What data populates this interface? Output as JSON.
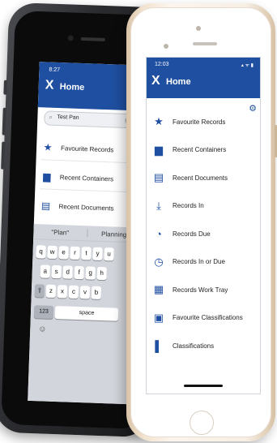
{
  "back_phone": {
    "time": "8:27",
    "title": "Home",
    "logo": "X",
    "search": {
      "value": "Test Pan"
    },
    "items": [
      {
        "label": "Favourite Records",
        "icon": "star-icon",
        "glyph": "★"
      },
      {
        "label": "Recent Containers",
        "icon": "folder-icon",
        "glyph": "▆"
      },
      {
        "label": "Recent Documents",
        "icon": "document-icon",
        "glyph": "▤"
      }
    ],
    "keyboard": {
      "suggestions": [
        "\"Plan\"",
        "Planning"
      ],
      "row1": [
        "q",
        "w",
        "e",
        "r",
        "t",
        "y",
        "u"
      ],
      "row2": [
        "a",
        "s",
        "d",
        "f",
        "g",
        "h"
      ],
      "row3": [
        "⇧",
        "z",
        "x",
        "c",
        "v",
        "b"
      ],
      "key_123": "123",
      "key_space": "space",
      "emoji": "☺"
    }
  },
  "front_phone": {
    "time": "12:03",
    "status": "▴ ᯤ ▮",
    "title": "Home",
    "logo": "X",
    "settings_glyph": "⚙",
    "items": [
      {
        "label": "Favourite Records",
        "icon": "star-icon",
        "glyph": "★"
      },
      {
        "label": "Recent Containers",
        "icon": "folder-icon",
        "glyph": "▆"
      },
      {
        "label": "Recent Documents",
        "icon": "document-icon",
        "glyph": "▤"
      },
      {
        "label": "Records In",
        "icon": "download-icon",
        "glyph": "⤓"
      },
      {
        "label": "Records Due",
        "icon": "clock-icon",
        "glyph": "◔"
      },
      {
        "label": "Records In or Due",
        "icon": "clock-download-icon",
        "glyph": "◷"
      },
      {
        "label": "Records Work Tray",
        "icon": "tray-icon",
        "glyph": "▦"
      },
      {
        "label": "Favourite Classifications",
        "icon": "classification-star-icon",
        "glyph": "▣"
      },
      {
        "label": "Classifications",
        "icon": "classification-icon",
        "glyph": "▌"
      }
    ]
  },
  "colors": {
    "brand": "#1f4fa0",
    "keyboard": "#d2d5db"
  }
}
